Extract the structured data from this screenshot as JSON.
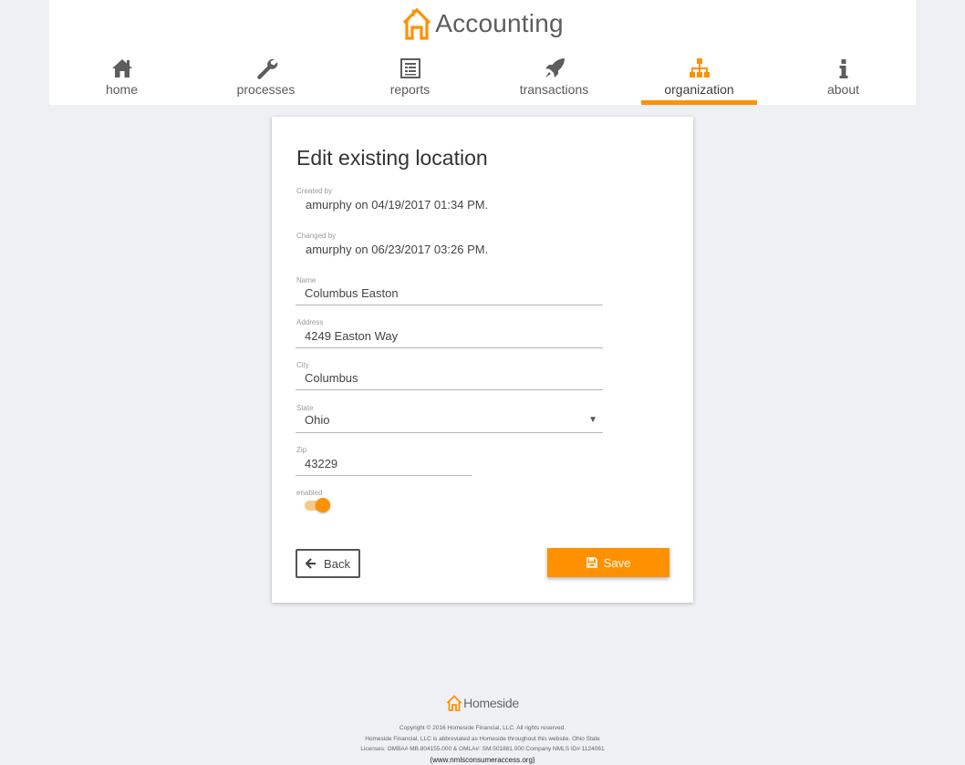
{
  "app": {
    "title": "Accounting"
  },
  "nav": {
    "items": [
      {
        "label": "home",
        "icon": "home-icon"
      },
      {
        "label": "processes",
        "icon": "wrench-icon"
      },
      {
        "label": "reports",
        "icon": "report-icon"
      },
      {
        "label": "transactions",
        "icon": "rocket-icon"
      },
      {
        "label": "organization",
        "icon": "sitemap-icon"
      },
      {
        "label": "about",
        "icon": "info-icon"
      }
    ],
    "active": "organization",
    "accent_color": "#ff9100"
  },
  "form": {
    "title": "Edit existing location",
    "created": {
      "label": "Created by",
      "value": "amurphy on 04/19/2017 01:34 PM."
    },
    "changed": {
      "label": "Changed by",
      "value": "amurphy on 06/23/2017 03:26 PM."
    },
    "name": {
      "label": "Name",
      "value": "Columbus Easton"
    },
    "address": {
      "label": "Address",
      "value": "4249 Easton Way"
    },
    "city": {
      "label": "City",
      "value": "Columbus"
    },
    "state": {
      "label": "State",
      "value": "Ohio"
    },
    "zip": {
      "label": "Zip",
      "value": "43229"
    },
    "enabled": {
      "label": "enabled",
      "value": true
    },
    "back_label": "Back",
    "save_label": "Save"
  },
  "footer": {
    "logo_text": "Homeside",
    "copyright": "Copyright © 2016 Homeside Financial, LLC. All rights reserved.",
    "line2": "Homeside Financial, LLC is abbreviated as Homeside throughout this website. Ohio State",
    "line3": "Licenses: OMBA# MB.804155.000 & OMLA#: SM.501881.000 Company NMLS ID# 1124061",
    "link": "(www.nmlsconsumeraccess.org)"
  }
}
